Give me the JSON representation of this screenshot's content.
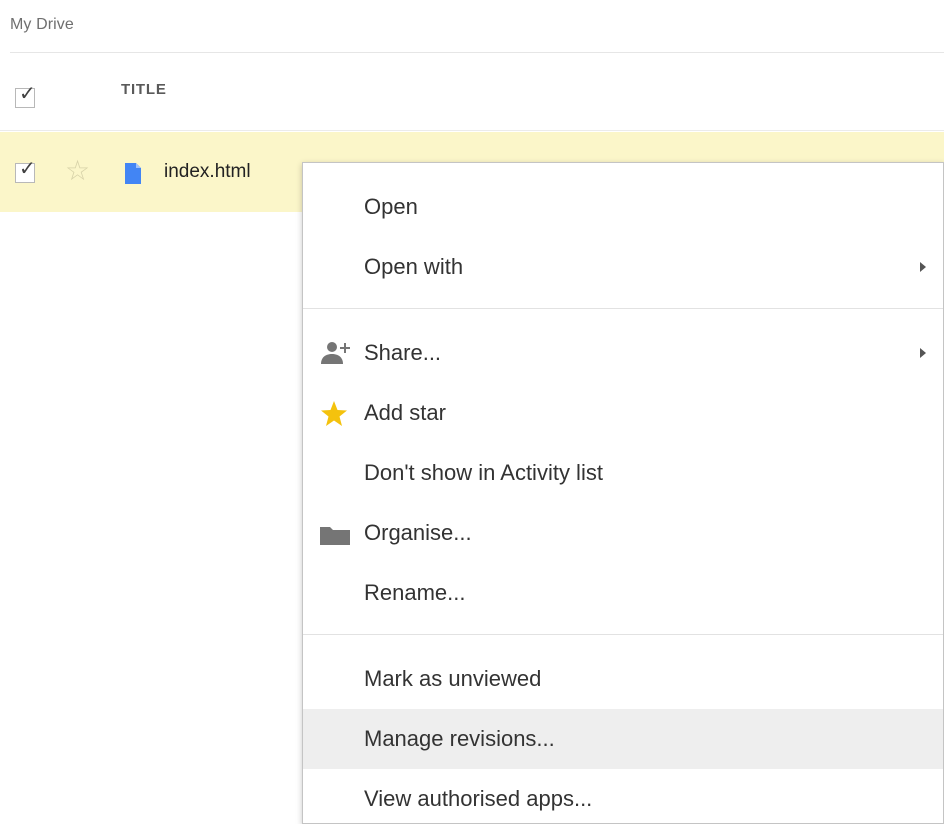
{
  "breadcrumb": {
    "label": "My Drive"
  },
  "file_list": {
    "header": {
      "title_label": "TITLE",
      "select_all_checked": true
    },
    "rows": [
      {
        "name": "index.html",
        "checked": true,
        "starred": false,
        "row_color": "#fbf6c9"
      }
    ]
  },
  "context_menu": {
    "items": [
      {
        "label": "Open",
        "icon": "",
        "has_submenu": false
      },
      {
        "label": "Open with",
        "icon": "",
        "has_submenu": true
      },
      {
        "label": "Share...",
        "icon": "add-person-icon",
        "has_submenu": true
      },
      {
        "label": "Add star",
        "icon": "star-icon",
        "has_submenu": false
      },
      {
        "label": "Don't show in Activity list",
        "icon": "",
        "has_submenu": false
      },
      {
        "label": "Organise...",
        "icon": "folder-icon",
        "has_submenu": false
      },
      {
        "label": "Rename...",
        "icon": "",
        "has_submenu": false
      },
      {
        "label": "Mark as unviewed",
        "icon": "",
        "has_submenu": false
      },
      {
        "label": "Manage revisions...",
        "icon": "",
        "has_submenu": false,
        "highlighted": true
      },
      {
        "label": "View authorised apps...",
        "icon": "",
        "has_submenu": false
      }
    ]
  },
  "colors": {
    "selected_row": "#fbf6c9",
    "file_icon": "#4285f4",
    "star": "#f4c20d",
    "menu_icon_gray": "#757575",
    "menu_hover": "#eeeeee"
  }
}
